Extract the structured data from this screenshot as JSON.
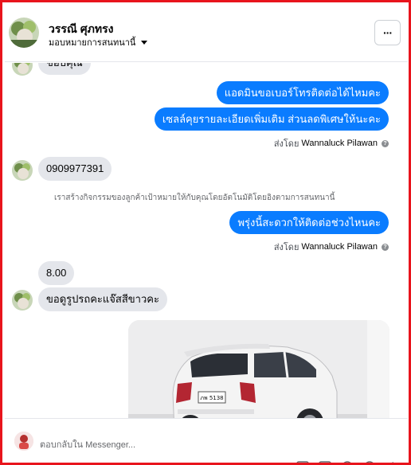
{
  "header": {
    "name": "วรรณี ศุภทรง",
    "subtitle": "มอบหมายการสนทนานี้",
    "more_label": "···"
  },
  "thread": {
    "partial_top_text": "ขอบคุณ",
    "outgoing_group_1": [
      "แอดมินขอเบอร์โทรติดต่อได้ไหมคะ",
      "เซลล์คุยรายละเอียดเพิ่มเติม ส่วนลดพิเศษให้นะคะ"
    ],
    "sent_by_prefix": "ส่งโดย",
    "sent_by_name": "Wannaluck Pilawan",
    "incoming_phone": "0909977391",
    "system_note": "เราสร้างกิจกรรมของลูกค้าเป้าหมายให้กับคุณโดยอัตโนมัติโดยอิงตามการสนทนานี้",
    "outgoing_group_2": [
      "พรุ่งนี้สะดวกให้ติดต่อช่วงไหนคะ"
    ],
    "incoming_time": "8.00",
    "incoming_request": "ขอดูรูปรถคะแจ๊สสีขาวคะ",
    "photo_plate": "ภพ 5138"
  },
  "composer": {
    "placeholder": "ตอบกลับใน Messenger..."
  },
  "colors": {
    "frame": "#e8141c",
    "outgoing_bubble": "#0a7cff",
    "incoming_bubble": "#e4e6eb"
  }
}
